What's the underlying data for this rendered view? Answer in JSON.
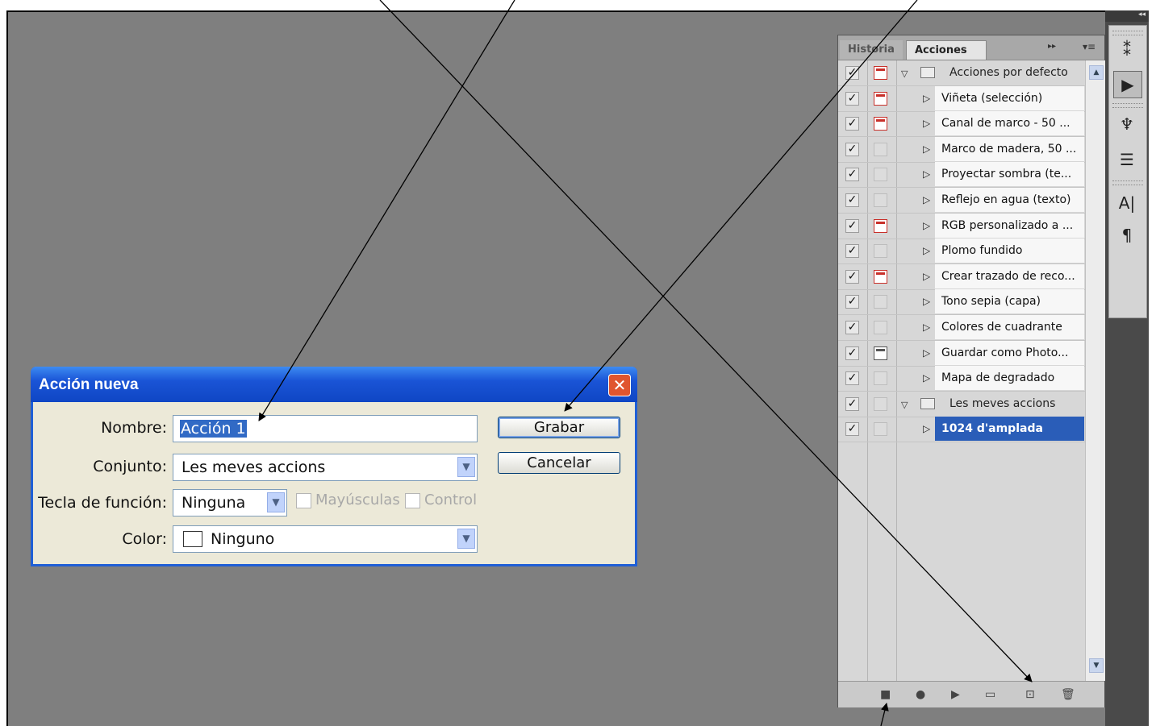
{
  "panel": {
    "tab_history": "Historia",
    "tab_actions": "Acciones",
    "rows": [
      {
        "type": "set",
        "label": "Acciones por defecto",
        "dialog": "red"
      },
      {
        "type": "action",
        "label": "Viñeta (selección)",
        "dialog": "red"
      },
      {
        "type": "action",
        "label": "Canal de marco - 50 ...",
        "dialog": "red"
      },
      {
        "type": "action",
        "label": "Marco de madera, 50 ...",
        "dialog": "empty"
      },
      {
        "type": "action",
        "label": "Proyectar sombra (te...",
        "dialog": "empty"
      },
      {
        "type": "action",
        "label": "Reflejo en agua (texto)",
        "dialog": "empty"
      },
      {
        "type": "action",
        "label": "RGB personalizado a ...",
        "dialog": "red"
      },
      {
        "type": "action",
        "label": "Plomo fundido",
        "dialog": "empty"
      },
      {
        "type": "action",
        "label": "Crear trazado de reco...",
        "dialog": "red"
      },
      {
        "type": "action",
        "label": "Tono sepia (capa)",
        "dialog": "empty"
      },
      {
        "type": "action",
        "label": "Colores de cuadrante",
        "dialog": "empty"
      },
      {
        "type": "action",
        "label": "Guardar como Photo...",
        "dialog": "gray"
      },
      {
        "type": "action",
        "label": "Mapa de degradado",
        "dialog": "empty"
      },
      {
        "type": "set",
        "label": "Les meves accions",
        "dialog": "empty"
      },
      {
        "type": "action",
        "label": "1024 d'amplada",
        "dialog": "empty",
        "selected": true
      }
    ]
  },
  "dialog": {
    "title": "Acción nueva",
    "close_symbol": "✕",
    "name_label": "Nombre:",
    "name_value": "Acción 1",
    "set_label": "Conjunto:",
    "set_value": "Les meves accions",
    "fkey_label": "Tecla de función:",
    "fkey_value": "Ninguna",
    "shift_label": "Mayúsculas",
    "control_label": "Control",
    "color_label": "Color:",
    "color_value": "Ninguno",
    "record_button": "Grabar",
    "cancel_button": "Cancelar"
  },
  "colors": {
    "canvas": "#7f7f7f",
    "selection": "#2a5db8",
    "xp_title": "#1a54d6"
  }
}
